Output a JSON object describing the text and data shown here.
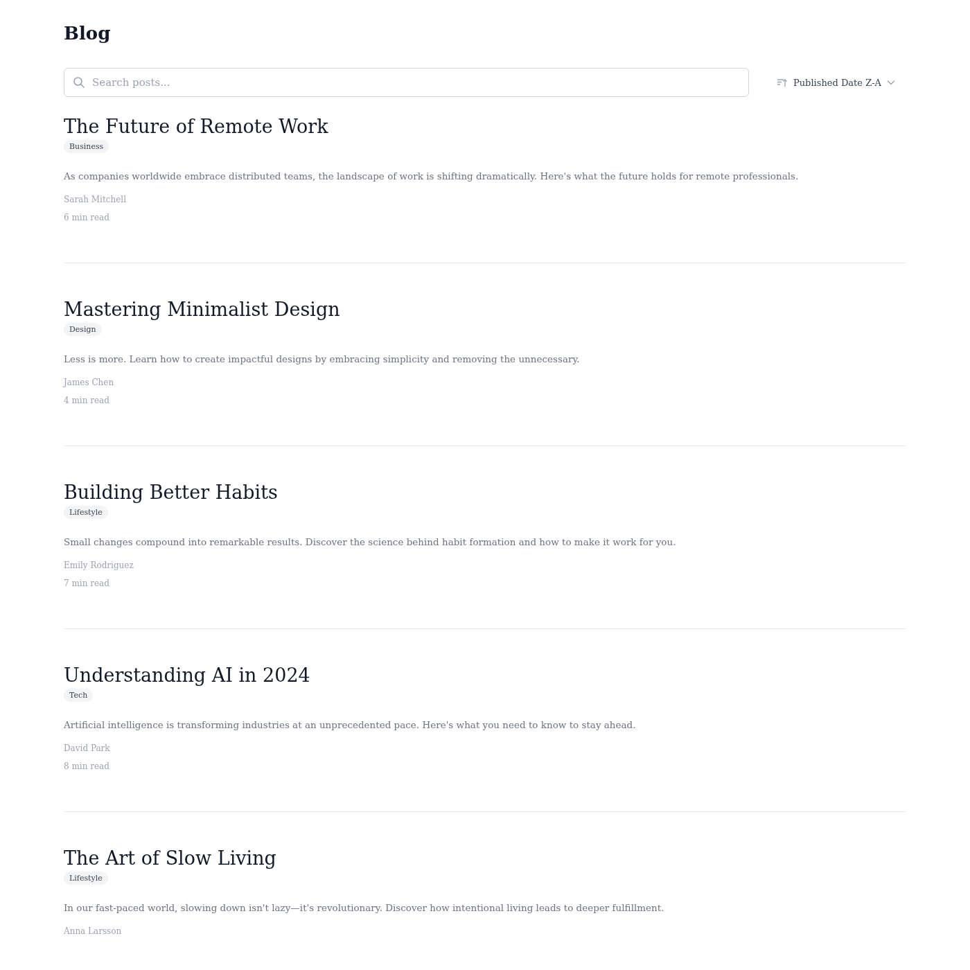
{
  "page_title": "Blog",
  "search": {
    "placeholder": "Search posts..."
  },
  "sort": {
    "label": "Published Date Z-A"
  },
  "posts": [
    {
      "title": "The Future of Remote Work",
      "tag": "Business",
      "excerpt": "As companies worldwide embrace distributed teams, the landscape of work is shifting dramatically. Here's what the future holds for remote professionals.",
      "author": "Sarah Mitchell",
      "read_time": "6 min read"
    },
    {
      "title": "Mastering Minimalist Design",
      "tag": "Design",
      "excerpt": "Less is more. Learn how to create impactful designs by embracing simplicity and removing the unnecessary.",
      "author": "James Chen",
      "read_time": "4 min read"
    },
    {
      "title": "Building Better Habits",
      "tag": "Lifestyle",
      "excerpt": "Small changes compound into remarkable results. Discover the science behind habit formation and how to make it work for you.",
      "author": "Emily Rodriguez",
      "read_time": "7 min read"
    },
    {
      "title": "Understanding AI in 2024",
      "tag": "Tech",
      "excerpt": "Artificial intelligence is transforming industries at an unprecedented pace. Here's what you need to know to stay ahead.",
      "author": "David Park",
      "read_time": "8 min read"
    },
    {
      "title": "The Art of Slow Living",
      "tag": "Lifestyle",
      "excerpt": "In our fast-paced world, slowing down isn't lazy—it's revolutionary. Discover how intentional living leads to deeper fulfillment.",
      "author": "Anna Larsson"
    }
  ]
}
